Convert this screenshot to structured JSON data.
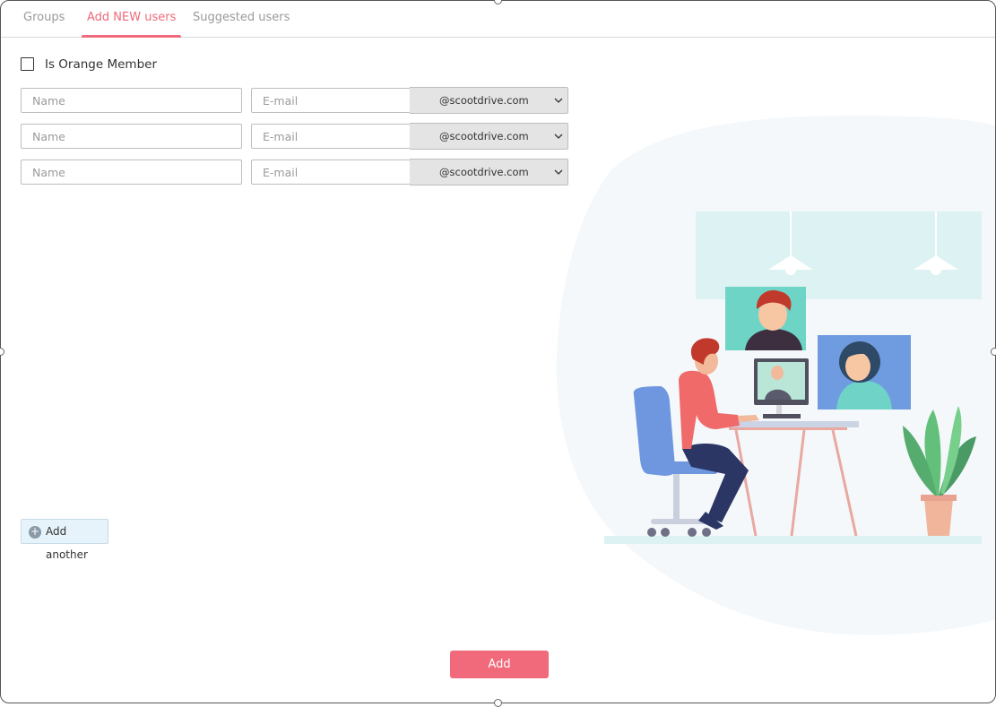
{
  "tabs": [
    {
      "label": "Groups"
    },
    {
      "label": "Add NEW users"
    },
    {
      "label": "Suggested users"
    }
  ],
  "form": {
    "member_checkbox_label": "Is Orange Member",
    "rows": [
      {
        "name_placeholder": "Name",
        "email_placeholder": "E-mail",
        "domain": "@scootdrive.com"
      },
      {
        "name_placeholder": "Name",
        "email_placeholder": "E-mail",
        "domain": "@scootdrive.com"
      },
      {
        "name_placeholder": "Name",
        "email_placeholder": "E-mail",
        "domain": "@scootdrive.com"
      }
    ],
    "add_another_label": "Add another",
    "submit_label": "Add"
  },
  "colors": {
    "accent": "#f06a7c",
    "tab_inactive": "#9a9a9a",
    "select_bg": "#e4e4e4",
    "add_another_bg": "#e7f3fa"
  }
}
